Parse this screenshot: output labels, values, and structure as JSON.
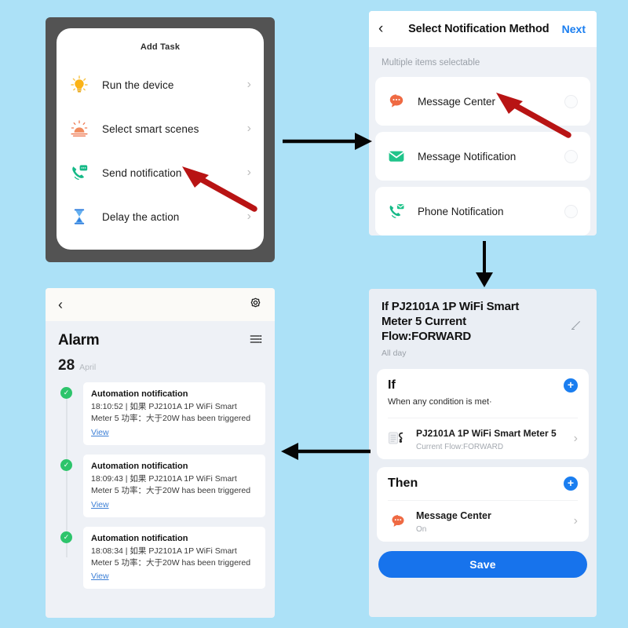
{
  "colors": {
    "background": "#ace1f7",
    "phone_frame": "#535353",
    "accent_blue": "#1a7ef0",
    "save_blue": "#1773ec",
    "red_arrow": "#b81414",
    "green_dot": "#2dc46b",
    "link_blue": "#3c7fd6"
  },
  "panel_add_task": {
    "title": "Add Task",
    "items": [
      {
        "label": "Run the device",
        "icon": "lightbulb-icon",
        "chevron": "›"
      },
      {
        "label": "Select smart scenes",
        "icon": "sunrise-scene-icon",
        "chevron": "›"
      },
      {
        "label": "Send notification",
        "icon": "phone-message-icon",
        "chevron": "›"
      },
      {
        "label": "Delay the action",
        "icon": "hourglass-icon",
        "chevron": "›"
      }
    ]
  },
  "panel_notification_method": {
    "back": "‹",
    "title": "Select Notification Method",
    "next": "Next",
    "subtitle": "Multiple items selectable",
    "items": [
      {
        "label": "Message Center",
        "icon": "speech-bubble-icon",
        "selected": false
      },
      {
        "label": "Message Notification",
        "icon": "envelope-icon",
        "selected": false
      },
      {
        "label": "Phone Notification",
        "icon": "phone-envelope-icon",
        "selected": false
      }
    ]
  },
  "panel_automation": {
    "title": "If PJ2101A 1P WiFi Smart Meter  5 Current Flow:FORWARD",
    "all_day": "All day",
    "edit_icon": "pencil-icon",
    "if_card": {
      "keyword": "If",
      "add_label": "+",
      "condition_text": "When any condition is met·",
      "item_name": "PJ2101A 1P WiFi Smart Meter 5",
      "item_sub": "Current Flow:FORWARD",
      "item_icon": "smart-meter-icon",
      "chevron": "›"
    },
    "then_card": {
      "keyword": "Then",
      "add_label": "+",
      "item_name": "Message Center",
      "item_sub": "On",
      "item_icon": "speech-bubble-icon",
      "chevron": "›"
    },
    "save_label": "Save"
  },
  "panel_alarm": {
    "back": "‹",
    "settings_icon": "gear-icon",
    "title": "Alarm",
    "filter_icon": "filter-list-icon",
    "date_day": "28",
    "date_month": "April",
    "notifications": [
      {
        "title": "Automation notification",
        "body": "18:10:52 | 如果 PJ2101A 1P WiFi Smart Meter  5 功率：大于20W has been triggered",
        "link": "View",
        "status": "success"
      },
      {
        "title": "Automation notification",
        "body": "18:09:43 | 如果 PJ2101A 1P WiFi Smart Meter  5 功率：大于20W has been triggered",
        "link": "View",
        "status": "success"
      },
      {
        "title": "Automation notification",
        "body": "18:08:34 | 如果 PJ2101A 1P WiFi Smart Meter  5 功率：大于20W has been triggered",
        "link": "View",
        "status": "success"
      }
    ]
  },
  "flow_arrows": [
    {
      "name": "arrow-add-task-to-notify-method",
      "direction": "right"
    },
    {
      "name": "arrow-notify-method-to-automation",
      "direction": "down"
    },
    {
      "name": "arrow-automation-to-alarm",
      "direction": "left"
    }
  ],
  "callout_arrows": [
    {
      "name": "callout-send-notification",
      "points_to": "Send notification"
    },
    {
      "name": "callout-message-center",
      "points_to": "Message Center"
    }
  ]
}
